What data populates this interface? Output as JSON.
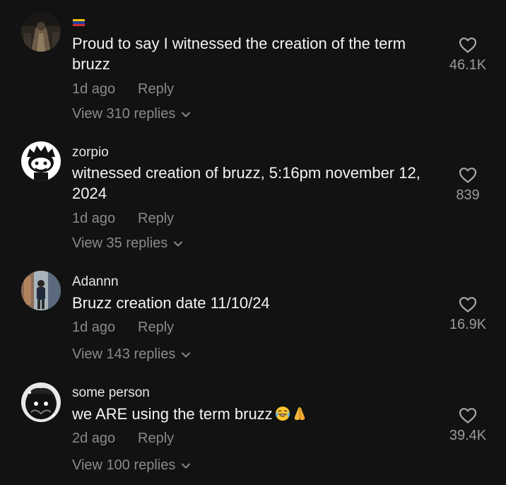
{
  "comments": [
    {
      "username": "",
      "text": "Proud to say I witnessed the creation of the term bruzz",
      "time": "1d ago",
      "reply_label": "Reply",
      "view_replies": "View 310 replies",
      "likes": "46.1K"
    },
    {
      "username": "zorpio",
      "text": "witnessed creation of bruzz, 5:16pm november 12, 2024",
      "time": "1d ago",
      "reply_label": "Reply",
      "view_replies": "View 35 replies",
      "likes": "839"
    },
    {
      "username": "Adannn",
      "text": "Bruzz creation date 11/10/24",
      "time": "1d ago",
      "reply_label": "Reply",
      "view_replies": "View 143 replies",
      "likes": "16.9K"
    },
    {
      "username": "some person",
      "text": "we ARE using the term bruzz",
      "time": "2d ago",
      "reply_label": "Reply",
      "view_replies": "View 100 replies",
      "likes": "39.4K"
    }
  ],
  "colors": {
    "background": "#121212",
    "text": "#f4f4f4",
    "muted": "#8a8a8a",
    "flag": [
      "#f2c200",
      "#1f3fa0",
      "#d22b2b"
    ]
  },
  "icons": [
    "heart-icon",
    "chevron-down-icon",
    "flag-icon",
    "laughing-emoji-icon",
    "praying-hands-emoji-icon"
  ]
}
